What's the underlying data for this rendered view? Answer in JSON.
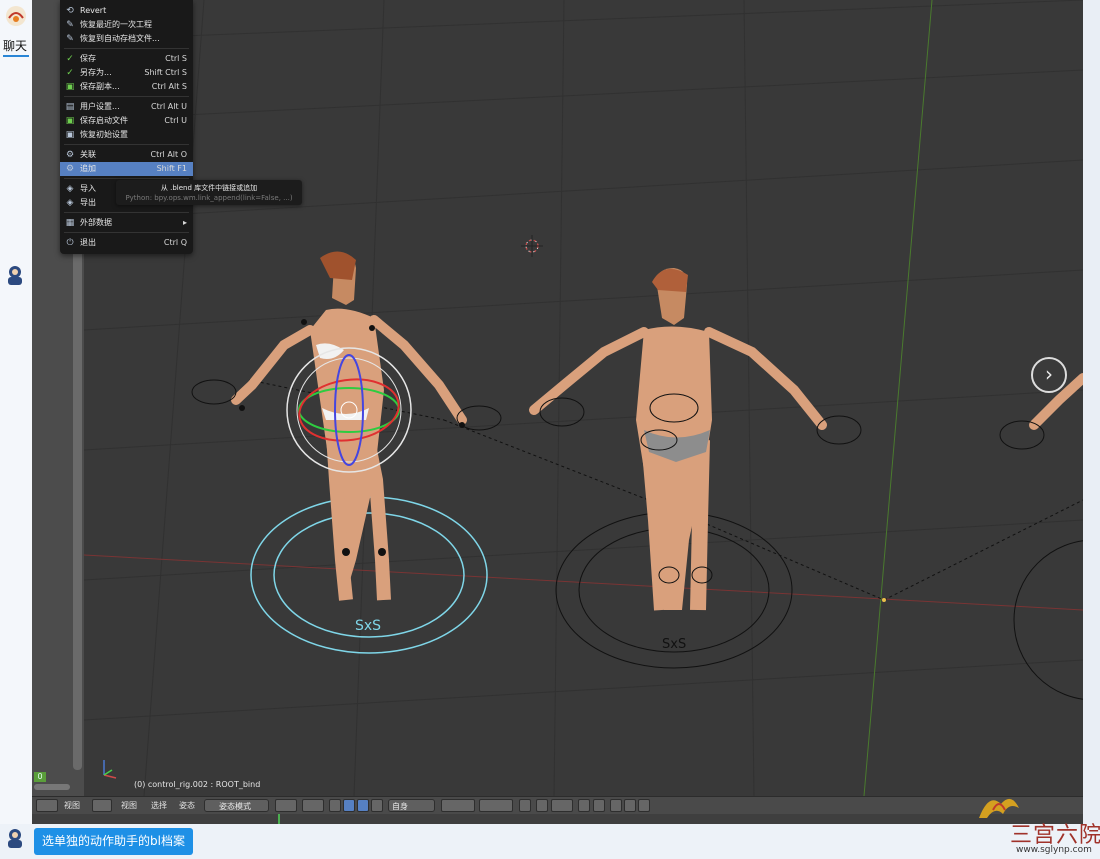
{
  "chat": {
    "tab_label": "聊天",
    "note": "选单独的动作助手的bl档案"
  },
  "menu": {
    "items": [
      {
        "icon": "revert-icon",
        "glyph": "⟲",
        "label": "Revert",
        "shortcut": ""
      },
      {
        "icon": "recover-last-icon",
        "glyph": "✎",
        "label": "恢复最近的一次工程",
        "shortcut": ""
      },
      {
        "icon": "recover-auto-icon",
        "glyph": "✎",
        "label": "恢复到自动存档文件...",
        "shortcut": ""
      },
      {
        "icon": "save-icon",
        "glyph": "✓",
        "label": "保存",
        "shortcut": "Ctrl S"
      },
      {
        "icon": "save-as-icon",
        "glyph": "✓",
        "label": "另存为...",
        "shortcut": "Shift Ctrl S"
      },
      {
        "icon": "save-copy-icon",
        "glyph": "▣",
        "label": "保存副本...",
        "shortcut": "Ctrl Alt S"
      },
      {
        "icon": "user-prefs-icon",
        "glyph": "▤",
        "label": "用户设置...",
        "shortcut": "Ctrl Alt U"
      },
      {
        "icon": "save-startup-icon",
        "glyph": "▣",
        "label": "保存启动文件",
        "shortcut": "Ctrl U"
      },
      {
        "icon": "factory-settings-icon",
        "glyph": "▣",
        "label": "恢复初始设置",
        "shortcut": ""
      },
      {
        "icon": "link-icon",
        "glyph": "⚙",
        "label": "关联",
        "shortcut": "Ctrl Alt O"
      },
      {
        "icon": "append-icon",
        "glyph": "⚙",
        "label": "追加",
        "shortcut": "Shift F1"
      },
      {
        "icon": "import-icon",
        "glyph": "◈",
        "label": "导入",
        "shortcut": ""
      },
      {
        "icon": "export-icon",
        "glyph": "◈",
        "label": "导出",
        "shortcut": ""
      },
      {
        "icon": "external-data-icon",
        "glyph": "▦",
        "label": "外部数据",
        "shortcut": "▸"
      },
      {
        "icon": "quit-icon",
        "glyph": "⏻",
        "label": "退出",
        "shortcut": "Ctrl Q"
      }
    ]
  },
  "tooltip": {
    "line1": "从 .blend 库文件中链接或追加",
    "line2": "Python: bpy.ops.wm.link_append(link=False, ...)"
  },
  "viewport": {
    "object_label": "(0) control_rig.002 : ROOT_bind",
    "frame": "0"
  },
  "header": {
    "view1": "视图",
    "view2": "视图",
    "select": "选择",
    "pose": "姿态",
    "mode": "姿态模式",
    "orientation": "自身"
  },
  "watermark": {
    "text": "三宫六院",
    "url": "www.sglynp.com"
  },
  "colors": {
    "viewport_bg": "#393939",
    "menu_bg": "#191919",
    "highlight": "#5680c2",
    "note_bg": "#1e90e6"
  }
}
